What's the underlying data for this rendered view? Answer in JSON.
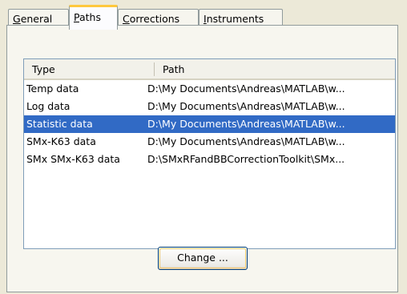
{
  "tabs": [
    {
      "label": "General",
      "mnemonic": "G",
      "rest": "eneral"
    },
    {
      "label": "Paths",
      "mnemonic": "P",
      "rest": "aths"
    },
    {
      "label": "Corrections",
      "mnemonic": "C",
      "rest": "orrections"
    },
    {
      "label": "Instruments",
      "mnemonic": "I",
      "rest": "nstruments"
    }
  ],
  "active_tab": "Paths",
  "list": {
    "columns": [
      "Type",
      "Path"
    ],
    "rows": [
      {
        "type": "Temp data",
        "path": "D:\\My Documents\\Andreas\\MATLAB\\w..."
      },
      {
        "type": "Log data",
        "path": "D:\\My Documents\\Andreas\\MATLAB\\w..."
      },
      {
        "type": "Statistic data",
        "path": "D:\\My Documents\\Andreas\\MATLAB\\w...",
        "selected": true
      },
      {
        "type": "SMx-K63 data",
        "path": "D:\\My Documents\\Andreas\\MATLAB\\w..."
      },
      {
        "type": "SMx SMx-K63 data",
        "path": "D:\\SMxRFandBBCorrectionToolkit\\SMx..."
      }
    ]
  },
  "buttons": {
    "change": "Change ..."
  },
  "colors": {
    "selection": "#316ac5",
    "active_tab_accent": "#ffc83c",
    "panel": "#f7f6ef"
  }
}
